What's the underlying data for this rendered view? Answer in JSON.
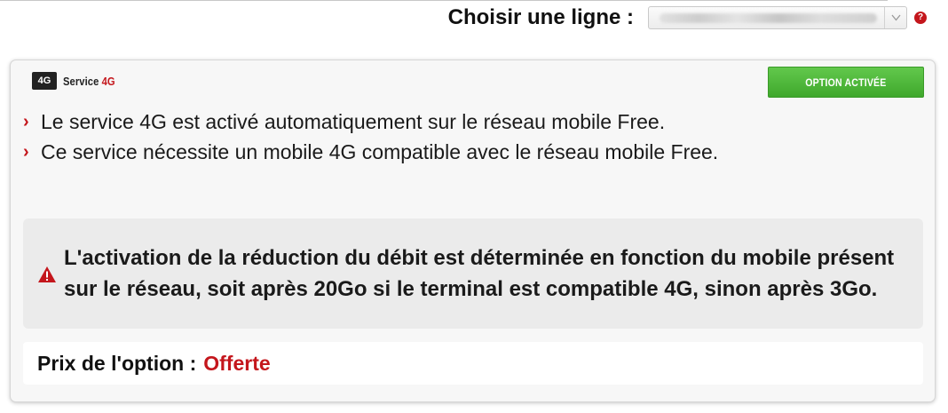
{
  "line_chooser": {
    "label": "Choisir une ligne :",
    "selected_value": "",
    "arrow_glyph": "v",
    "help_glyph": "?"
  },
  "card": {
    "badge": "4G",
    "service_title_prefix": "Service",
    "service_title_accent": "4G",
    "status": "OPTION ACTIVÉE",
    "bullet_glyph": "›",
    "bullets": [
      "Le service 4G est activé automatiquement sur le réseau mobile Free.",
      "Ce service nécessite un mobile 4G compatible avec le réseau mobile Free."
    ],
    "warning": "L'activation de la réduction du débit est déterminée en fonction du mobile présent sur le réseau, soit après 20Go si le terminal est compatible 4G, sinon après 3Go.",
    "price_label": "Prix de l'option :",
    "price_value": "Offerte"
  },
  "colors": {
    "accent_red": "#c4161c",
    "status_green": "#4cb634",
    "card_bg": "#f7f7f7",
    "warning_bg": "#ebebeb"
  },
  "icons": {
    "help": "help-icon",
    "dropdown": "chevron-down-icon",
    "warning": "warning-icon"
  }
}
